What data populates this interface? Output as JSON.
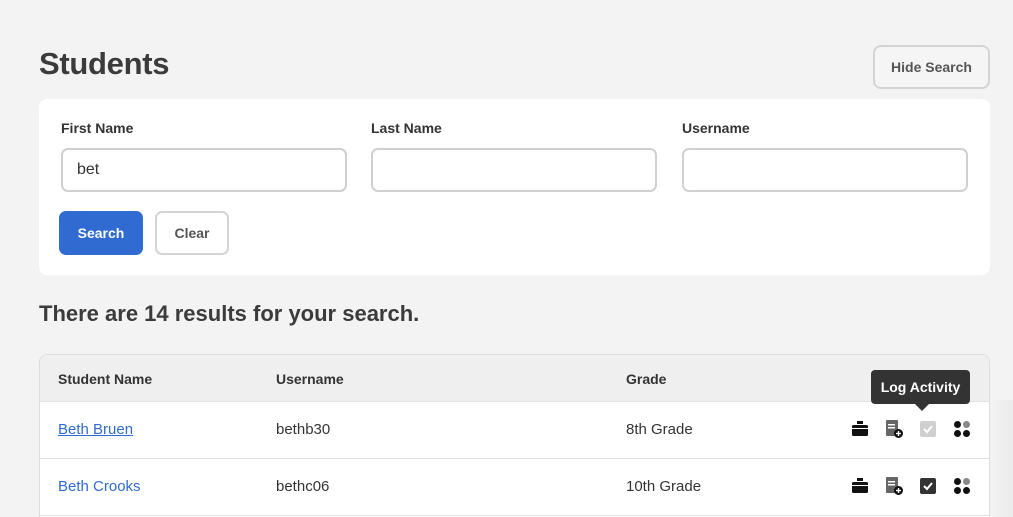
{
  "page": {
    "title": "Students",
    "hide_search_label": "Hide Search"
  },
  "search": {
    "first_name": {
      "label": "First Name",
      "value": "bet",
      "placeholder": ""
    },
    "last_name": {
      "label": "Last Name",
      "value": "",
      "placeholder": ""
    },
    "username": {
      "label": "Username",
      "value": "",
      "placeholder": ""
    },
    "search_label": "Search",
    "clear_label": "Clear"
  },
  "results": {
    "summary": "There are 14 results for your search."
  },
  "table": {
    "columns": [
      "Student Name",
      "Username",
      "Grade"
    ],
    "rows": [
      {
        "name": "Beth Bruen",
        "username": "bethb30",
        "grade": "8th Grade"
      },
      {
        "name": "Beth Crooks",
        "username": "bethc06",
        "grade": "10th Grade"
      }
    ]
  },
  "tooltip": {
    "text": "Log Activity"
  },
  "icons": {
    "row_actions": [
      "briefcase-icon",
      "add-document-icon",
      "checkbox-icon",
      "dots-grid-icon"
    ]
  },
  "colors": {
    "primary": "#2f6bd1",
    "background": "#f3f3f3",
    "tooltip_bg": "#333333"
  }
}
